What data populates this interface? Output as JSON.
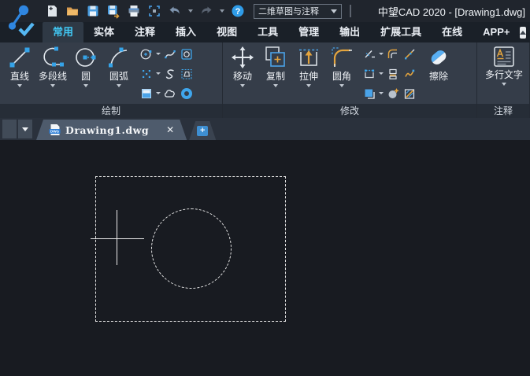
{
  "colors": {
    "titlebar_bg": "#20252d",
    "ribbon_bg": "#353d49",
    "panel_label_bg": "#262d37",
    "active_tab_text": "#41c8f4",
    "canvas_bg": "#181b21",
    "accent_blue": "#3fa6ec",
    "accent_orange": "#e3a43e",
    "doc_tab_bg": "#4e5b6c"
  },
  "glyphs": {
    "help": "?",
    "close_tab": "✕",
    "new_tab_plus": "+",
    "dwg_badge": "DWG"
  },
  "title_bar": {
    "workspace_selector": "二维草图与注释",
    "window_title": "中望CAD 2020 - [Drawing1.dwg]",
    "quick_access_icons": [
      "new-file",
      "open-folder",
      "save",
      "save-as",
      "print",
      "plot-preview",
      "undo",
      "redo",
      "help"
    ]
  },
  "ribbon": {
    "tabs": [
      {
        "label": "常用",
        "active": true
      },
      {
        "label": "实体",
        "active": false
      },
      {
        "label": "注释",
        "active": false
      },
      {
        "label": "插入",
        "active": false
      },
      {
        "label": "视图",
        "active": false
      },
      {
        "label": "工具",
        "active": false
      },
      {
        "label": "管理",
        "active": false
      },
      {
        "label": "输出",
        "active": false
      },
      {
        "label": "扩展工具",
        "active": false
      },
      {
        "label": "在线",
        "active": false
      },
      {
        "label": "APP+",
        "active": false
      }
    ],
    "panels": [
      {
        "label": "绘制",
        "buttons": [
          {
            "label": "直线",
            "dropdown": true
          },
          {
            "label": "多段线",
            "dropdown": true
          },
          {
            "label": "圆",
            "dropdown": true
          },
          {
            "label": "圆弧",
            "dropdown": true
          }
        ],
        "small_tool_icons": [
          "ellipse",
          "spline",
          "region",
          "point",
          "spline-cv",
          "hatch",
          "gradient",
          "revision-cloud",
          "donut"
        ]
      },
      {
        "label": "修改",
        "buttons": [
          {
            "label": "移动",
            "dropdown": true
          },
          {
            "label": "复制",
            "dropdown": true
          },
          {
            "label": "拉伸",
            "dropdown": true
          },
          {
            "label": "圆角",
            "dropdown": true
          },
          {
            "label": "擦除",
            "dropdown": false
          }
        ],
        "small_tool_icons": [
          "trim",
          "offset",
          "extend",
          "scale",
          "align",
          "edit-polyline",
          "array",
          "explode",
          "edit-hatch"
        ]
      },
      {
        "label": "注释",
        "buttons": [
          {
            "label": "多行文字",
            "dropdown": true
          }
        ]
      }
    ]
  },
  "doc_tab_bar": {
    "tabs": [
      {
        "label": "Drawing1.dwg",
        "active": true
      }
    ]
  },
  "canvas": {
    "objects": [
      {
        "name": "selection-window-rectangle",
        "style": "dashed"
      },
      {
        "name": "selected-circle",
        "style": "dashed"
      },
      {
        "name": "crosshair-cursor",
        "style": "solid"
      }
    ]
  }
}
